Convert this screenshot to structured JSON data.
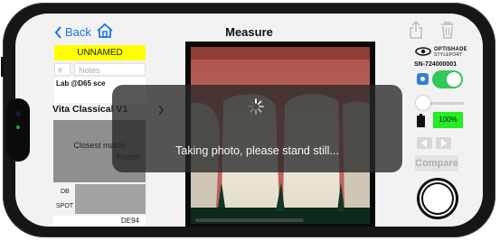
{
  "nav": {
    "back_label": "Back",
    "title": "Measure"
  },
  "sample": {
    "name": "UNNAMED",
    "number_placeholder": "#",
    "notes_placeholder": "Notes",
    "lab_label": "Lab @D65 sce"
  },
  "shade": {
    "guide_name": "Vita Classical V1",
    "closest_match_label": "Closest match",
    "closest_match_value": "Footer"
  },
  "database": {
    "db_label": "DB",
    "spot_label": "SPOT",
    "de_label": "DE94"
  },
  "device": {
    "brand_line1": "OPTISHADE",
    "brand_line2": "STYLEPORT",
    "serial": "SN-724000001",
    "battery_label": "100%",
    "flash_on": true
  },
  "controls": {
    "compare_label": "Compare"
  },
  "overlay": {
    "message": "Taking photo, please stand still..."
  },
  "colors": {
    "accent": "#1a73e8",
    "name_highlight": "#ffff00",
    "toggle_on": "#34c759",
    "battery_ok": "#22ee22"
  },
  "icons": [
    "chevron-left-icon",
    "home-icon",
    "share-icon",
    "trash-icon",
    "eye-logo-icon",
    "camera-icon",
    "battery-icon",
    "arrow-left-icon",
    "arrow-right-icon",
    "spinner-icon"
  ]
}
